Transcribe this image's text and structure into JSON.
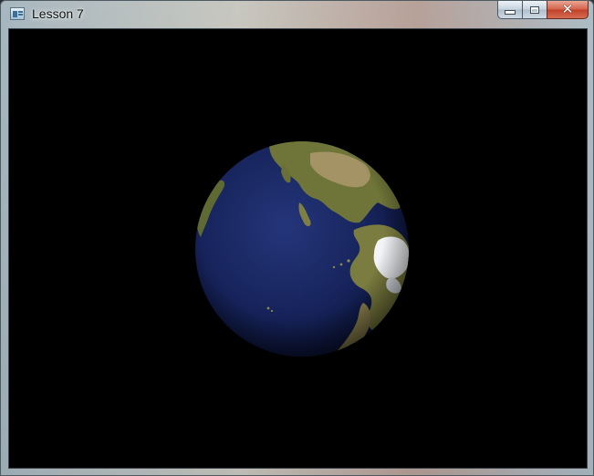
{
  "window": {
    "title": "Lesson 7",
    "controls": {
      "minimize_icon": "minimize-icon",
      "maximize_icon": "maximize-icon",
      "close_icon": "close-icon",
      "close_glyph": "✕"
    }
  },
  "scene": {
    "background_color": "#000000",
    "subject": "textured-earth-globe",
    "ocean_color": "#1b2a66",
    "land_color": "#6f7a3a",
    "ice_color": "#ffffff"
  }
}
